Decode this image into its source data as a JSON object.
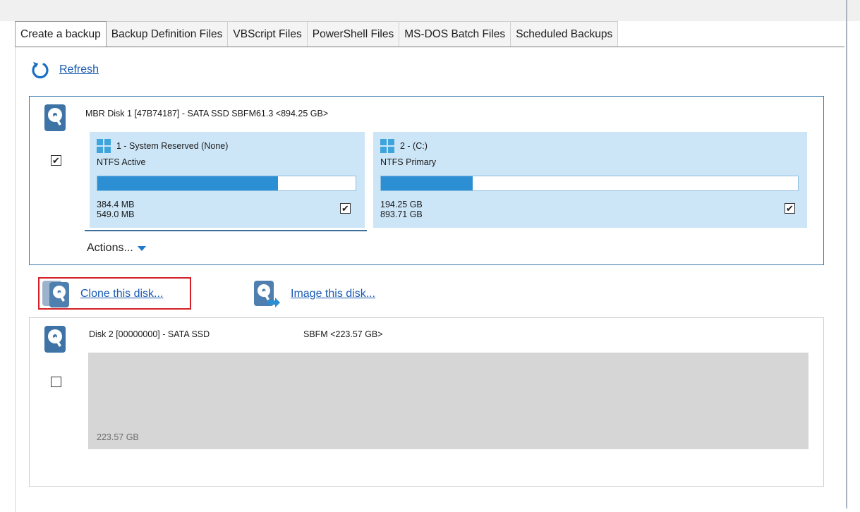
{
  "tabs": [
    {
      "label": "Create a backup",
      "active": true
    },
    {
      "label": "Backup Definition Files",
      "active": false
    },
    {
      "label": "VBScript Files",
      "active": false
    },
    {
      "label": "PowerShell Files",
      "active": false
    },
    {
      "label": "MS-DOS Batch Files",
      "active": false
    },
    {
      "label": "Scheduled Backups",
      "active": false
    }
  ],
  "refresh": {
    "label": "Refresh",
    "icon": "refresh-icon"
  },
  "disk1": {
    "icon": "hard-disk-icon",
    "title": "MBR Disk 1 [47B74187] - SATA SSD SBFM61.3  <894.25 GB>",
    "selected": true,
    "partitions": [
      {
        "name": "1 - System Reserved (None)",
        "fs": "NTFS Active",
        "used": "384.4 MB",
        "total": "549.0 MB",
        "used_fraction": 0.7,
        "selected": true,
        "icon": "windows-logo-icon"
      },
      {
        "name": "2 -  (C:)",
        "fs": "NTFS Primary",
        "used": "194.25 GB",
        "total": "893.71 GB",
        "used_fraction": 0.22,
        "selected": true,
        "icon": "windows-logo-icon"
      }
    ],
    "actions_label": "Actions..."
  },
  "disk_actions": {
    "clone_label": "Clone this disk...",
    "image_label": "Image this disk..."
  },
  "disk2": {
    "icon": "hard-disk-icon",
    "title_left": "Disk 2 [00000000] - SATA SSD",
    "title_right": "SBFM  <223.57 GB>",
    "selected": false,
    "unallocated_size": "223.57 GB"
  },
  "colors": {
    "link": "#1a5bb4",
    "partition_bg": "#cde6f7",
    "bar_fill": "#2d8fd3",
    "highlight": "#d51f26",
    "disk1_border": "#3d7aaa"
  }
}
